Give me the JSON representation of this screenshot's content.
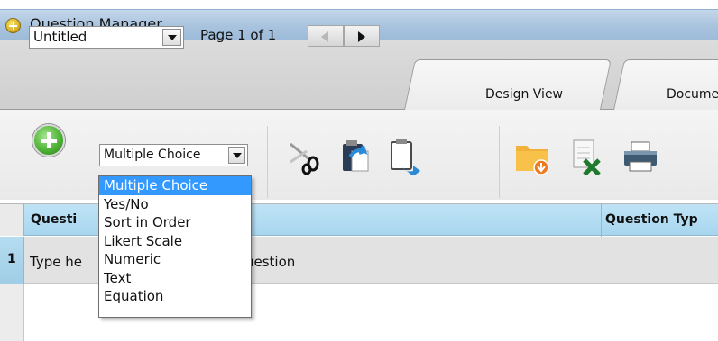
{
  "window": {
    "title": "Question Manager"
  },
  "top": {
    "document_name": "Untitled",
    "page_label": "Page 1 of 1",
    "tabs": [
      {
        "label": "Design View",
        "active": true
      },
      {
        "label": "Documen",
        "active": false
      }
    ]
  },
  "toolbar": {
    "question_type_selected": "Multiple Choice",
    "tools": [
      "add-icon",
      "scissors-icon",
      "paste-icon",
      "clipboard-export-icon",
      "folder-download-icon",
      "excel-export-icon",
      "printer-icon"
    ]
  },
  "dropdown": {
    "options": [
      "Multiple Choice",
      "Yes/No",
      "Sort in Order",
      "Likert Scale",
      "Numeric",
      "Text",
      "Equation"
    ],
    "selected_index": 0
  },
  "grid": {
    "columns": [
      "Questi",
      "Question Typ"
    ],
    "rows": [
      {
        "number": "1",
        "text_left": "Type he",
        "text_right": "uestion"
      }
    ]
  },
  "colors": {
    "selection_blue": "#3399ff",
    "header_blue": "#a8d6ef"
  }
}
